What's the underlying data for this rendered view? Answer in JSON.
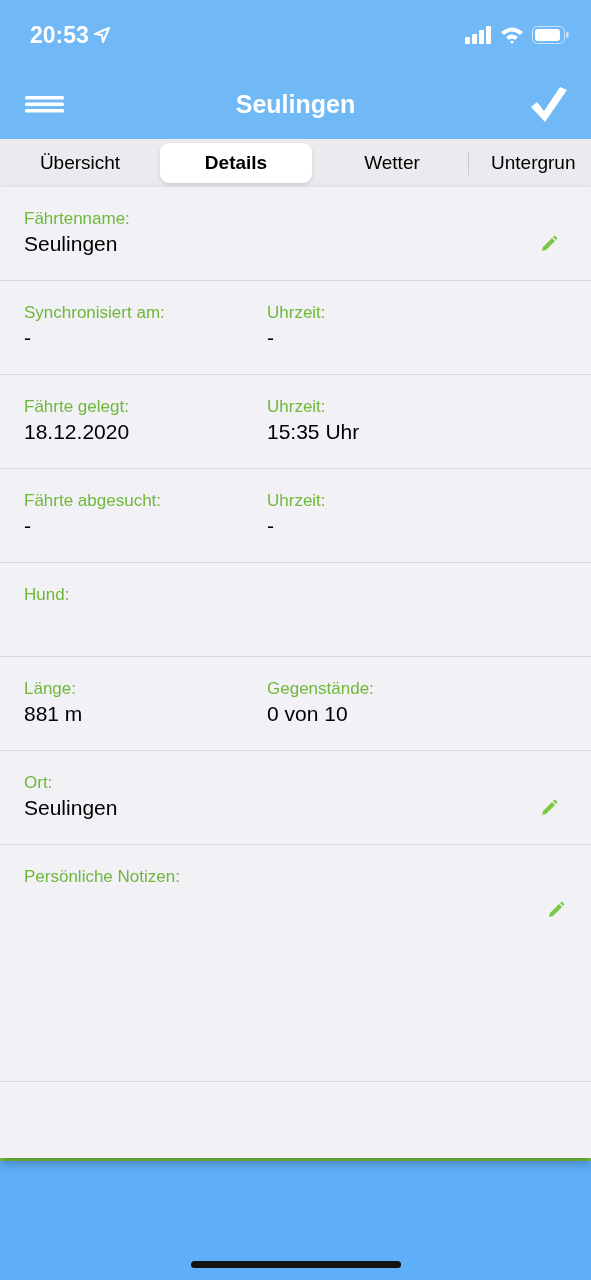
{
  "status_bar": {
    "time": "20:53"
  },
  "nav_bar": {
    "title": "Seulingen"
  },
  "tabs": [
    {
      "label": "Übersicht",
      "selected": false
    },
    {
      "label": "Details",
      "selected": true
    },
    {
      "label": "Wetter",
      "selected": false
    },
    {
      "label": "Untergrun",
      "selected": false
    }
  ],
  "rows": [
    {
      "kind": "single",
      "editable": true,
      "fields": [
        {
          "label": "Fährtenname:",
          "value": "Seulingen"
        }
      ]
    },
    {
      "kind": "pair",
      "editable": false,
      "fields": [
        {
          "label": "Synchronisiert am:",
          "value": "-"
        },
        {
          "label": "Uhrzeit:",
          "value": "-"
        }
      ]
    },
    {
      "kind": "pair",
      "editable": false,
      "fields": [
        {
          "label": "Fährte gelegt:",
          "value": "18.12.2020"
        },
        {
          "label": "Uhrzeit:",
          "value": "15:35 Uhr"
        }
      ]
    },
    {
      "kind": "pair",
      "editable": false,
      "fields": [
        {
          "label": "Fährte abgesucht:",
          "value": "-"
        },
        {
          "label": "Uhrzeit:",
          "value": "-"
        }
      ]
    },
    {
      "kind": "single",
      "editable": false,
      "fields": [
        {
          "label": "Hund:"
        }
      ]
    },
    {
      "kind": "pair",
      "editable": false,
      "fields": [
        {
          "label": "Länge:",
          "value": "881 m"
        },
        {
          "label": "Gegenstände:",
          "value": "0 von 10"
        }
      ]
    },
    {
      "kind": "single",
      "editable": true,
      "fields": [
        {
          "label": "Ort:",
          "value": "Seulingen"
        }
      ]
    },
    {
      "kind": "notes",
      "editable": true,
      "fields": [
        {
          "label": "Persönliche Notizen:"
        }
      ]
    }
  ]
}
